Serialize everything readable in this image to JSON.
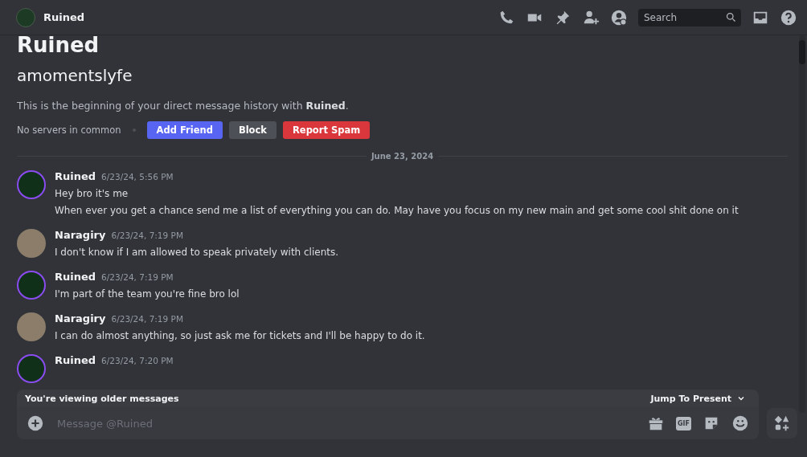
{
  "header": {
    "name": "Ruined",
    "search": {
      "placeholder": "Search"
    }
  },
  "intro": {
    "title": "Ruined",
    "username": "amomentslyfe",
    "description": "This is the beginning of your direct message history with **Ruined**.",
    "mutual": "No servers in common",
    "buttons": [
      {
        "label": "Add Friend",
        "kind": "primary"
      },
      {
        "label": "Block",
        "kind": "secondary"
      },
      {
        "label": "Report Spam",
        "kind": "danger"
      }
    ]
  },
  "divider": "June 23, 2024",
  "messages": [
    {
      "author": "Ruined",
      "time": "6/23/24, 5:56 PM",
      "kind": "ring",
      "lines": [
        "Hey bro it's me",
        "When ever you get a chance send me a list of everything you can do. May have you focus on my new main and get some cool shit done on it"
      ]
    },
    {
      "author": "Naragiry",
      "time": "6/23/24, 7:19 PM",
      "kind": "plain",
      "lines": [
        "I don't know if I am allowed to speak privately with clients."
      ]
    },
    {
      "author": "Ruined",
      "time": "6/23/24, 7:19 PM",
      "kind": "ring",
      "lines": [
        "I'm part of the team you're fine bro lol"
      ]
    },
    {
      "author": "Naragiry",
      "time": "6/23/24, 7:19 PM",
      "kind": "plain",
      "lines": [
        "I can do almost anything, so just ask me for tickets and I'll be happy to do it."
      ]
    },
    {
      "author": "Ruined",
      "time": "6/23/24, 7:20 PM",
      "kind": "ring"
    }
  ],
  "older_bar": {
    "text": "You're viewing older messages",
    "action": "Jump To Present"
  },
  "composer": {
    "placeholder": "Message @Ruined",
    "gif": "GIF"
  }
}
